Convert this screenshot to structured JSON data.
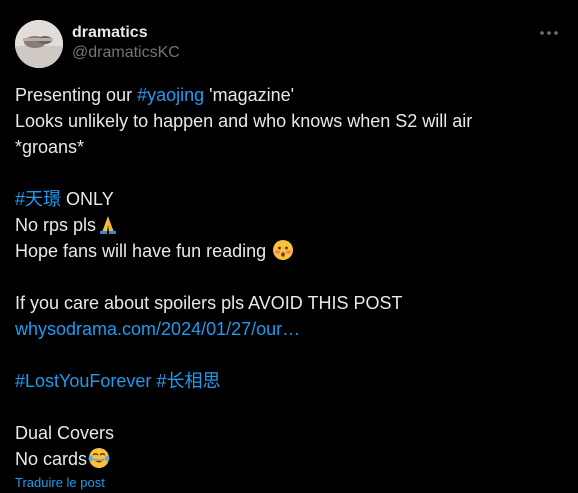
{
  "author": {
    "display_name": "dramatics",
    "handle": "@dramaticsKC"
  },
  "post": {
    "l1_pre": "Presenting our ",
    "l1_tag": "#yaojing",
    "l1_post": " 'magazine'",
    "l2": "Looks unlikely to happen and who knows when S2 will air",
    "l3": "*groans*",
    "l4_tag": "#天璟",
    "l4_post": " ONLY",
    "l5": "No rps pls",
    "l6": "Hope fans will have fun reading ",
    "l7": "If you care about spoilers pls AVOID THIS POST",
    "l8_link": "whysodrama.com/2024/01/27/our…",
    "l9_tag1": "#LostYouForever",
    "l9_space": " ",
    "l9_tag2": "#长相思",
    "l10": "Dual Covers",
    "l11": "No cards"
  },
  "icons": {
    "more": "more-dots-icon",
    "pray": "folded-hands-emoji",
    "shy": "flushed-face-emoji",
    "laugh": "tears-of-joy-emoji"
  },
  "translate_label": "Traduire le post",
  "colors": {
    "background": "#000000",
    "text": "#e7e9ea",
    "secondary": "#71767b",
    "link": "#1d9bf0"
  }
}
